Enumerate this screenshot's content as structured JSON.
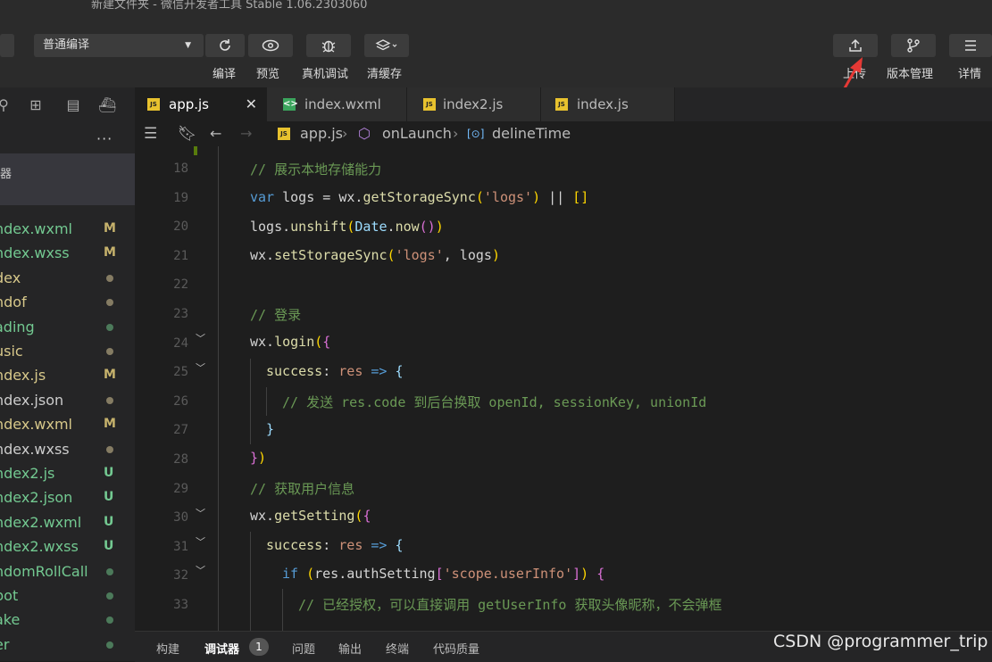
{
  "window": {
    "title": "新建文件夹 - 微信开发者工具 Stable 1.06.2303060"
  },
  "toolbar": {
    "mode": "普通编译",
    "compile": "编译",
    "preview": "预览",
    "real_debug": "真机调试",
    "clear_cache": "清缓存",
    "upload": "上传",
    "version": "版本管理",
    "details": "详情"
  },
  "sidebar": {
    "more": "···",
    "section": "器",
    "files": [
      {
        "name": "ndex.wxml",
        "status": "M",
        "color": "#73c991"
      },
      {
        "name": "ndex.wxss",
        "status": "M",
        "color": "#73c991"
      },
      {
        "name": "dex",
        "status": "",
        "color": "#d7c88a"
      },
      {
        "name": "ndof",
        "status": "",
        "color": "#d7c88a"
      },
      {
        "name": "ading",
        "status": "",
        "color": "#73c991"
      },
      {
        "name": "usic",
        "status": "",
        "color": "#d7c88a"
      },
      {
        "name": "ndex.js",
        "status": "M",
        "color": "#d7c88a"
      },
      {
        "name": "ndex.json",
        "status": "",
        "color": "#cccccc"
      },
      {
        "name": "ndex.wxml",
        "status": "M",
        "color": "#d7c88a"
      },
      {
        "name": "ndex.wxss",
        "status": "",
        "color": "#cccccc"
      },
      {
        "name": "ndex2.js",
        "status": "U",
        "color": "#73c991"
      },
      {
        "name": "ndex2.json",
        "status": "U",
        "color": "#73c991"
      },
      {
        "name": "ndex2.wxml",
        "status": "U",
        "color": "#73c991"
      },
      {
        "name": "ndex2.wxss",
        "status": "U",
        "color": "#73c991"
      },
      {
        "name": "ndomRollCall",
        "status": "",
        "color": "#73c991"
      },
      {
        "name": "bot",
        "status": "",
        "color": "#73c991"
      },
      {
        "name": "ake",
        "status": "",
        "color": "#73c991"
      },
      {
        "name": "er",
        "status": "",
        "color": "#73c991"
      }
    ]
  },
  "tabs": [
    {
      "label": "app.js",
      "icon": "JS"
    },
    {
      "label": "index.wxml",
      "icon": "<>"
    },
    {
      "label": "index2.js",
      "icon": "JS"
    },
    {
      "label": "index.js",
      "icon": "JS"
    }
  ],
  "breadcrumb": {
    "file": "app.js",
    "method": "onLaunch",
    "field": "delineTime"
  },
  "line_numbers": [
    "18",
    "19",
    "20",
    "21",
    "22",
    "23",
    "24",
    "25",
    "26",
    "27",
    "28",
    "29",
    "30",
    "31",
    "32",
    "33"
  ],
  "bottom": {
    "build": "构建",
    "debugger": "调试器",
    "badge": "1",
    "issues": "问题",
    "output": "输出",
    "terminal": "终端",
    "quality": "代码质量"
  },
  "watermark": "CSDN @programmer_trip"
}
